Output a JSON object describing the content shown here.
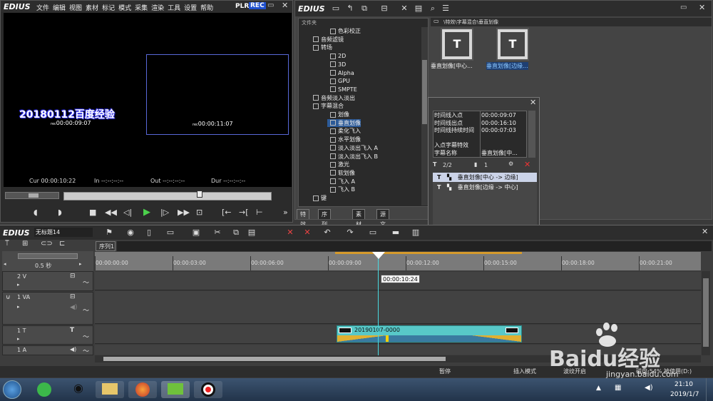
{
  "player": {
    "logo": "EDIUS",
    "menu": [
      "文件",
      "编辑",
      "视图",
      "素材",
      "标记",
      "模式",
      "采集",
      "渲染",
      "工具",
      "设置",
      "帮助"
    ],
    "plr": "PLR",
    "rec": "REC",
    "caption": "20180112百度经验",
    "left_tc_prefix": "rec",
    "left_tc": "00:00:09:07",
    "right_tc_prefix": "rec",
    "right_tc": "00:00:11:07",
    "cur_label": "Cur",
    "cur_value": "00:00:10:22",
    "in_label": "In",
    "in_value": "--:--:--:--",
    "out_label": "Out",
    "out_value": "--:--:--:--",
    "dur_label": "Dur",
    "dur_value": "--:--:--:--"
  },
  "library": {
    "logo": "EDIUS",
    "folder_header": "文件夹",
    "breadcrumb": "\\特效\\字幕混合\\垂直划像",
    "tree": [
      {
        "label": "色彩校正",
        "indent": 2
      },
      {
        "label": "音频滤镜",
        "indent": 1
      },
      {
        "label": "转场",
        "indent": 1
      },
      {
        "label": "2D",
        "indent": 2
      },
      {
        "label": "3D",
        "indent": 2
      },
      {
        "label": "Alpha",
        "indent": 2
      },
      {
        "label": "GPU",
        "indent": 2
      },
      {
        "label": "SMPTE",
        "indent": 2
      },
      {
        "label": "音频淡入淡出",
        "indent": 1
      },
      {
        "label": "字幕混合",
        "indent": 1
      },
      {
        "label": "划像",
        "indent": 2
      },
      {
        "label": "垂直划像",
        "indent": 2,
        "selected": true
      },
      {
        "label": "柔化飞入",
        "indent": 2
      },
      {
        "label": "水平划像",
        "indent": 2
      },
      {
        "label": "淡入淡出飞入 A",
        "indent": 2
      },
      {
        "label": "淡入淡出飞入 B",
        "indent": 2
      },
      {
        "label": "激光",
        "indent": 2
      },
      {
        "label": "软划像",
        "indent": 2
      },
      {
        "label": "飞入 A",
        "indent": 2
      },
      {
        "label": "飞入 B",
        "indent": 2
      },
      {
        "label": "键",
        "indent": 1
      }
    ],
    "tabs": [
      "特效",
      "序列标记",
      "素材库",
      "源文件浏览"
    ],
    "thumbs": [
      {
        "label": "垂直划像[中心..."
      },
      {
        "label": "垂直划像[边缘..."
      }
    ]
  },
  "info": {
    "rows": [
      {
        "k": "时间线入点",
        "v": "00:00:09:07"
      },
      {
        "k": "时间线出点",
        "v": "00:00:16:10"
      },
      {
        "k": "时间线持续时间",
        "v": "00:00:07:03"
      },
      {
        "k": "",
        "v": ""
      },
      {
        "k": "入点字幕特效",
        "v": ""
      },
      {
        "k": "字幕名称",
        "v": "垂直划像[中..."
      }
    ],
    "count": "2/2",
    "layer": "1",
    "effects": [
      "垂直划像[中心 -> 边缘]",
      "垂直划像[边缘 -> 中心]"
    ],
    "tab": "信息"
  },
  "timeline": {
    "logo": "EDIUS",
    "project": "无标题14",
    "sequence_tab": "序列1",
    "zoom": "0.5 秒",
    "ruler": [
      "00:00:00:00",
      "00:00:03:00",
      "00:00:06:00",
      "00:00:09:00",
      "00:00:12:00",
      "00:00:15:00",
      "00:00:18:00",
      "00:00:21:00"
    ],
    "cursor_tc": "00:00:10:24",
    "tracks": [
      "2 V",
      "1 VA",
      "1 T",
      "1 A"
    ],
    "clip_name": "20190107-0000",
    "status": [
      "暂停",
      "插入模式",
      "波纹开启",
      "磁盘:54% 被使用(D:)"
    ]
  },
  "taskbar": {
    "time": "21:10",
    "date": "2019/1/7"
  },
  "watermark": {
    "text": "Baidu经验",
    "url": "jingyan.baidu.com"
  }
}
